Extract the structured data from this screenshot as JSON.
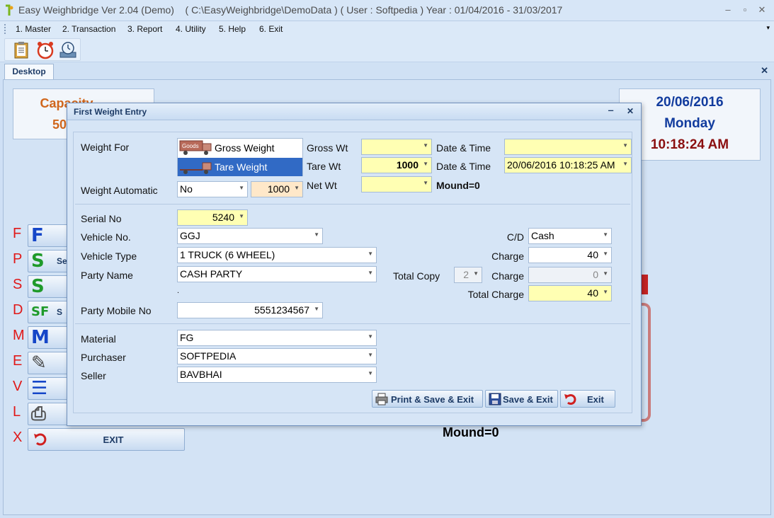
{
  "app": {
    "title": "Easy Weighbridge Ver 2.04 (Demo)    ( C:\\EasyWeighbridge\\DemoData ) ( User : Softpedia ) Year : 01/04/2016 - 31/03/2017",
    "window_buttons": {
      "minimize": "‒",
      "restore": "▫",
      "close": "✕"
    }
  },
  "menu": {
    "items": [
      "1. Master",
      "2. Transaction",
      "3. Report",
      "4. Utility",
      "5. Help",
      "6. Exit"
    ],
    "overflow": "▾"
  },
  "toolbar": {
    "icons": [
      "clipboard-icon",
      "alarm-clock-icon",
      "backup-clock-icon"
    ]
  },
  "tabs": {
    "active": "Desktop",
    "close": "✕"
  },
  "desktop": {
    "capacity_label": "Capacity",
    "capacity_value": "50",
    "date": "20/06/2016",
    "day": "Monday",
    "time": "10:18:24 AM",
    "mound": "Mound=0",
    "shortcuts": [
      {
        "key": "F",
        "glyph": "F",
        "icon": "f-letter-icon",
        "color": "#1546c8",
        "text": ""
      },
      {
        "key": "P",
        "glyph": "S",
        "icon": "s-letter-icon",
        "color": "#1f9a2a",
        "text": "Se"
      },
      {
        "key": "S",
        "glyph": "S",
        "icon": "s-letter-icon",
        "color": "#1f9a2a",
        "text": ""
      },
      {
        "key": "D",
        "glyph": "SF",
        "icon": "sf-letter-icon",
        "color": "#1f9a2a",
        "text": "S"
      },
      {
        "key": "M",
        "glyph": "M",
        "icon": "m-letter-icon",
        "color": "#1546c8",
        "text": ""
      },
      {
        "key": "E",
        "glyph": "✎",
        "icon": "edit-icon",
        "color": "#444444",
        "text": ""
      },
      {
        "key": "V",
        "glyph": "☰",
        "icon": "list-icon",
        "color": "#1546c8",
        "text": ""
      },
      {
        "key": "L",
        "glyph": "⎙",
        "icon": "printer-icon",
        "color": "#555555",
        "text": ""
      }
    ],
    "exit_key": "X",
    "exit_label": "EXIT",
    "watermark": "SOFTPEDIA"
  },
  "dialog": {
    "title": "First Weight Entry",
    "minimize": "‒",
    "close": "✕",
    "weight_for_label": "Weight For",
    "weight_for_options": [
      {
        "label": "Gross Weight",
        "badge": "Goods",
        "selected": false
      },
      {
        "label": "Tare Weight",
        "badge": "",
        "selected": true
      }
    ],
    "weight_automatic_label": "Weight Automatic",
    "weight_automatic_value": "No",
    "weight_automatic_reading": "1000",
    "gross_wt_label": "Gross Wt",
    "gross_wt_value": "",
    "tare_wt_label": "Tare Wt",
    "tare_wt_value": "1000",
    "net_wt_label": "Net Wt",
    "net_wt_value": "",
    "datetime1_label": "Date & Time",
    "datetime1_value": "",
    "datetime2_label": "Date & Time",
    "datetime2_value": "20/06/2016 10:18:25 AM",
    "mound": "Mound=0",
    "serial_label": "Serial No",
    "serial_value": "5240",
    "vehicle_no_label": "Vehicle No.",
    "vehicle_no_value": "GGJ",
    "vehicle_type_label": "Vehicle Type",
    "vehicle_type_value": "1 TRUCK (6 WHEEL)",
    "party_name_label": "Party Name",
    "party_name_value": "CASH PARTY",
    "dot": ".",
    "party_mobile_label": "Party Mobile No",
    "party_mobile_value": "5551234567",
    "material_label": "Material",
    "material_value": "FG",
    "purchaser_label": "Purchaser",
    "purchaser_value": "SOFTPEDIA",
    "seller_label": "Seller",
    "seller_value": "BAVBHAI",
    "cd_label": "C/D",
    "cd_value": "Cash",
    "charge1_label": "Charge",
    "charge1_value": "40",
    "total_copy_label": "Total Copy",
    "total_copy_value": "2",
    "charge2_label": "Charge",
    "charge2_value": "0",
    "total_charge_label": "Total Charge",
    "total_charge_value": "40",
    "buttons": {
      "print_save_exit": "Print & Save & Exit",
      "save_exit": "Save & Exit",
      "exit": "Exit"
    }
  }
}
